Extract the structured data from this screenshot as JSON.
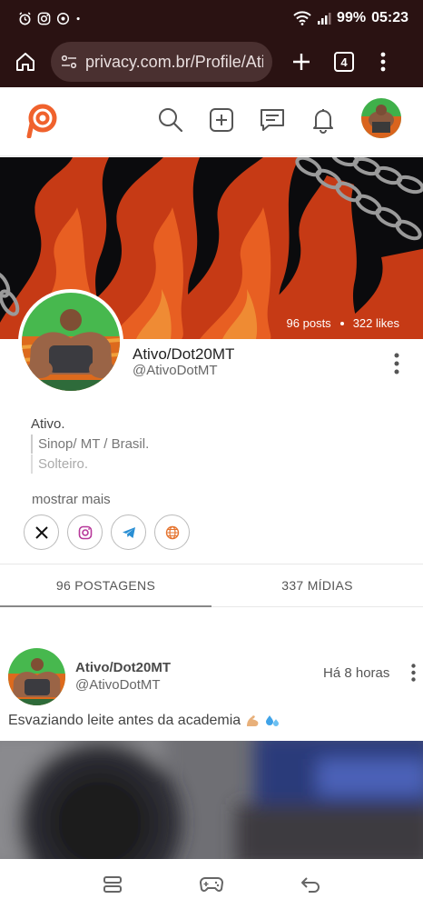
{
  "status_bar": {
    "battery": "99%",
    "time": "05:23",
    "notification_icons": [
      "alarm-icon",
      "instagram-icon",
      "chat-icon",
      "dot-icon"
    ]
  },
  "browser": {
    "url": "privacy.com.br/Profile/AtivoDotMT",
    "tab_count": "4"
  },
  "profile": {
    "stats": {
      "posts": "96 posts",
      "likes": "322 likes"
    },
    "name": "Ativo/Dot20MT",
    "handle": "@AtivoDotMT",
    "bio": {
      "line1": "Ativo.",
      "line2": "Sinop/ MT / Brasil.",
      "line3": "Solteiro."
    },
    "show_more": "mostrar mais",
    "social_links": [
      "x-icon",
      "instagram-icon",
      "telegram-icon",
      "globe-icon"
    ]
  },
  "tabs": [
    {
      "label": "96 POSTAGENS",
      "active": true
    },
    {
      "label": "337 MÍDIAS",
      "active": false
    }
  ],
  "post": {
    "author_name": "Ativo/Dot20MT",
    "author_handle": "@AtivoDotMT",
    "time": "Há 8 horas",
    "text": "Esvaziando leite antes da academia",
    "emojis": [
      "flexed-biceps-icon",
      "sweat-droplets-icon"
    ]
  },
  "colors": {
    "brand": "#f0622d",
    "statusbar_bg": "#2a1212"
  }
}
